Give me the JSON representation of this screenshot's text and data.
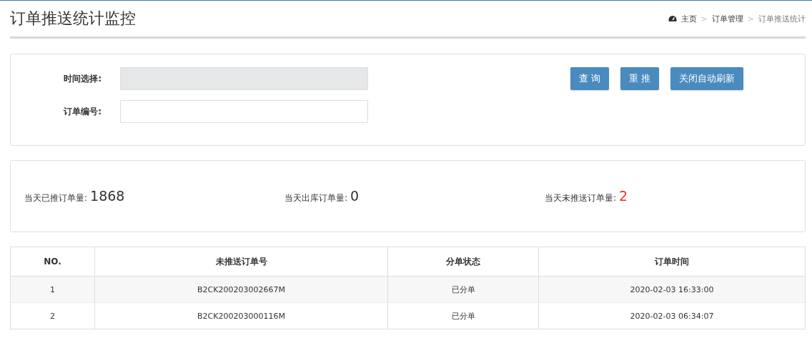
{
  "page": {
    "title": "订单推送统计监控"
  },
  "breadcrumb": [
    {
      "label": "主页",
      "kind": "home"
    },
    {
      "separator": ">",
      "label": "订单管理",
      "kind": "link"
    },
    {
      "separator": ">",
      "label": "订单推送统计",
      "kind": "current"
    }
  ],
  "filters": [
    {
      "label": "时间选择:",
      "disabled": true
    },
    {
      "label": "订单编号:",
      "disabled": false
    }
  ],
  "buttons": [
    "查 询",
    "重 推",
    "关闭自动刷新"
  ],
  "stats": [
    {
      "label": "当天已推订单量:",
      "value": "1868",
      "color": "#333333"
    },
    {
      "label": "当天出库订单量:",
      "value": "0",
      "color": "#333333"
    },
    {
      "label": "当天未推送订单量:",
      "value": "2",
      "color": "#e8332a"
    }
  ],
  "table": {
    "columns": [
      "NO.",
      "未推送订单号",
      "分单状态",
      "订单时间"
    ],
    "rows": [
      [
        "1",
        "B2CK200203002667M",
        "已分单",
        "2020-02-03 16:33:00"
      ],
      [
        "2",
        "B2CK200203000116M",
        "已分单",
        "2020-02-03 06:34:07"
      ]
    ]
  }
}
